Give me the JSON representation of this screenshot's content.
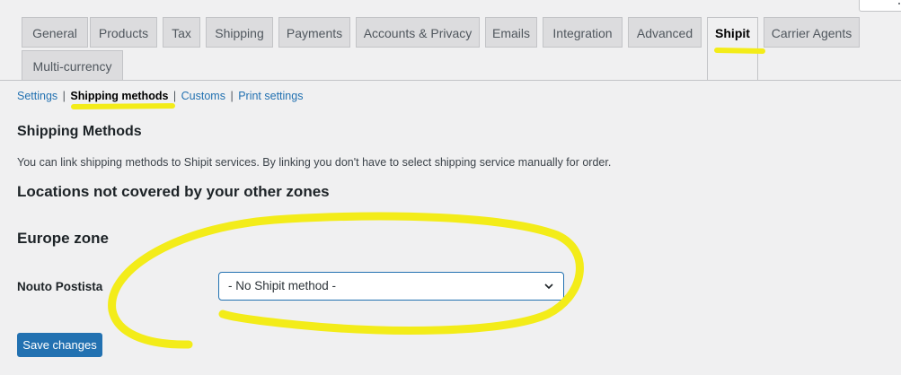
{
  "tabs": [
    {
      "label": "General",
      "active": false
    },
    {
      "label": "Products",
      "active": false
    },
    {
      "label": "Tax",
      "active": false
    },
    {
      "label": "Shipping",
      "active": false
    },
    {
      "label": "Payments",
      "active": false
    },
    {
      "label": "Accounts & Privacy",
      "active": false
    },
    {
      "label": "Emails",
      "active": false
    },
    {
      "label": "Integration",
      "active": false
    },
    {
      "label": "Advanced",
      "active": false
    },
    {
      "label": "Shipit",
      "active": true
    },
    {
      "label": "Carrier Agents",
      "active": false
    },
    {
      "label": "Multi-currency",
      "active": false
    }
  ],
  "subnav": {
    "settings": "Settings",
    "shipping_methods": "Shipping methods",
    "customs": "Customs",
    "print_settings": "Print settings",
    "separator": "|"
  },
  "section": {
    "title": "Shipping Methods",
    "description": "You can link shipping methods to Shipit services. By linking you don't have to select shipping service manually for order."
  },
  "zones": {
    "other_title": "Locations not covered by your other zones",
    "europe_title": "Europe zone"
  },
  "field": {
    "label": "Nouto Postista",
    "selected_value": "- No Shipit method -"
  },
  "buttons": {
    "save": "Save changes"
  },
  "colors": {
    "accent": "#2271b1",
    "highlight": "#f3ec19"
  }
}
